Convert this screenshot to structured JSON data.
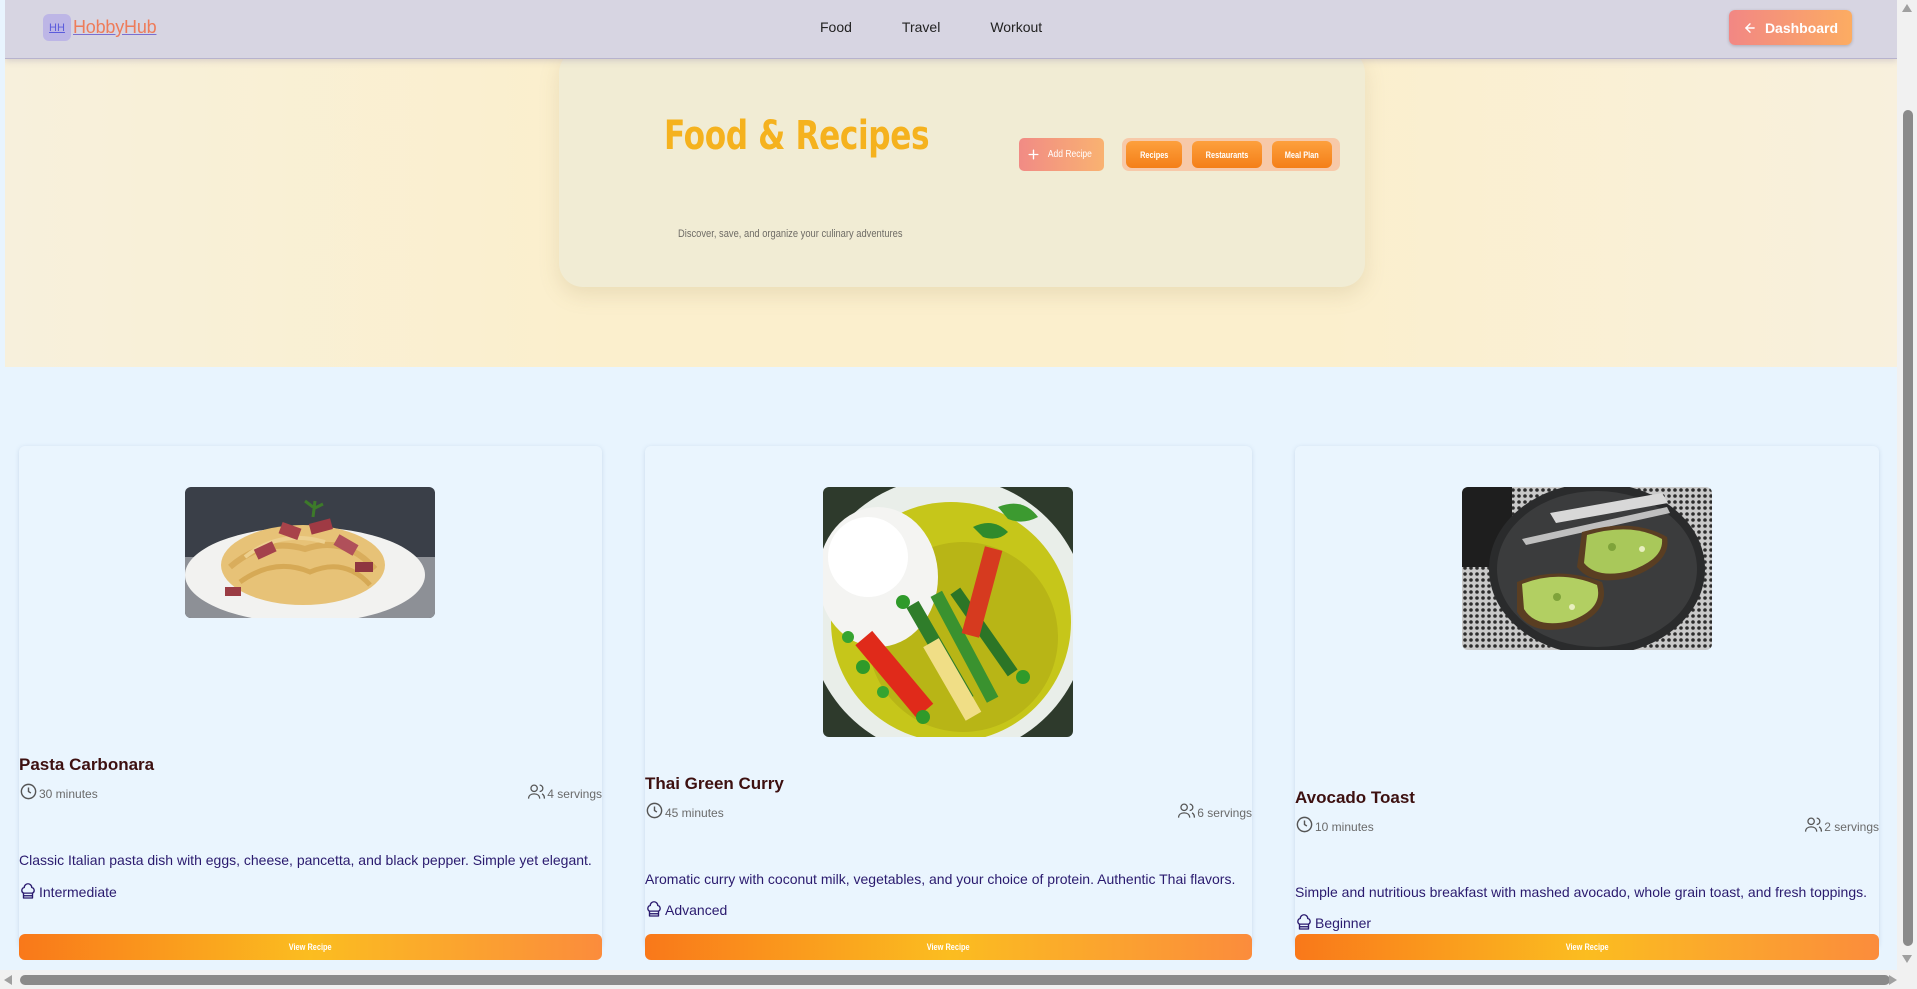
{
  "nav": {
    "logo_badge": "HH",
    "logo_text": "HobbyHub",
    "links": [
      "Food",
      "Travel",
      "Workout"
    ],
    "dashboard_label": "Dashboard"
  },
  "hero": {
    "title": "Food & Recipes",
    "subtitle": "Discover, save, and organize your culinary adventures",
    "add_label": "Add Recipe",
    "tabs": [
      "Recipes",
      "Restaurants",
      "Meal Plan"
    ]
  },
  "recipes": [
    {
      "title": "Pasta Carbonara",
      "time": "30 minutes",
      "servings": "4 servings",
      "description": "Classic Italian pasta dish with eggs, cheese, pancetta, and black pepper. Simple yet elegant.",
      "level": "Intermediate",
      "button": "View Recipe",
      "image_icon": "pasta-image"
    },
    {
      "title": "Thai Green Curry",
      "time": "45 minutes",
      "servings": "6 servings",
      "description": "Aromatic curry with coconut milk, vegetables, and your choice of protein. Authentic Thai flavors.",
      "level": "Advanced",
      "button": "View Recipe",
      "image_icon": "curry-image"
    },
    {
      "title": "Avocado Toast",
      "time": "10 minutes",
      "servings": "2 servings",
      "description": "Simple and nutritious breakfast with mashed avocado, whole grain toast, and fresh toppings.",
      "level": "Beginner",
      "button": "View Recipe",
      "image_icon": "toast-image"
    }
  ],
  "colors": {
    "accent_orange": "#f9781a",
    "accent_yellow": "#fbbd20",
    "title_yellow": "#f5b21e",
    "text_purple": "#2a1a6e",
    "title_brown": "#3d1010"
  }
}
